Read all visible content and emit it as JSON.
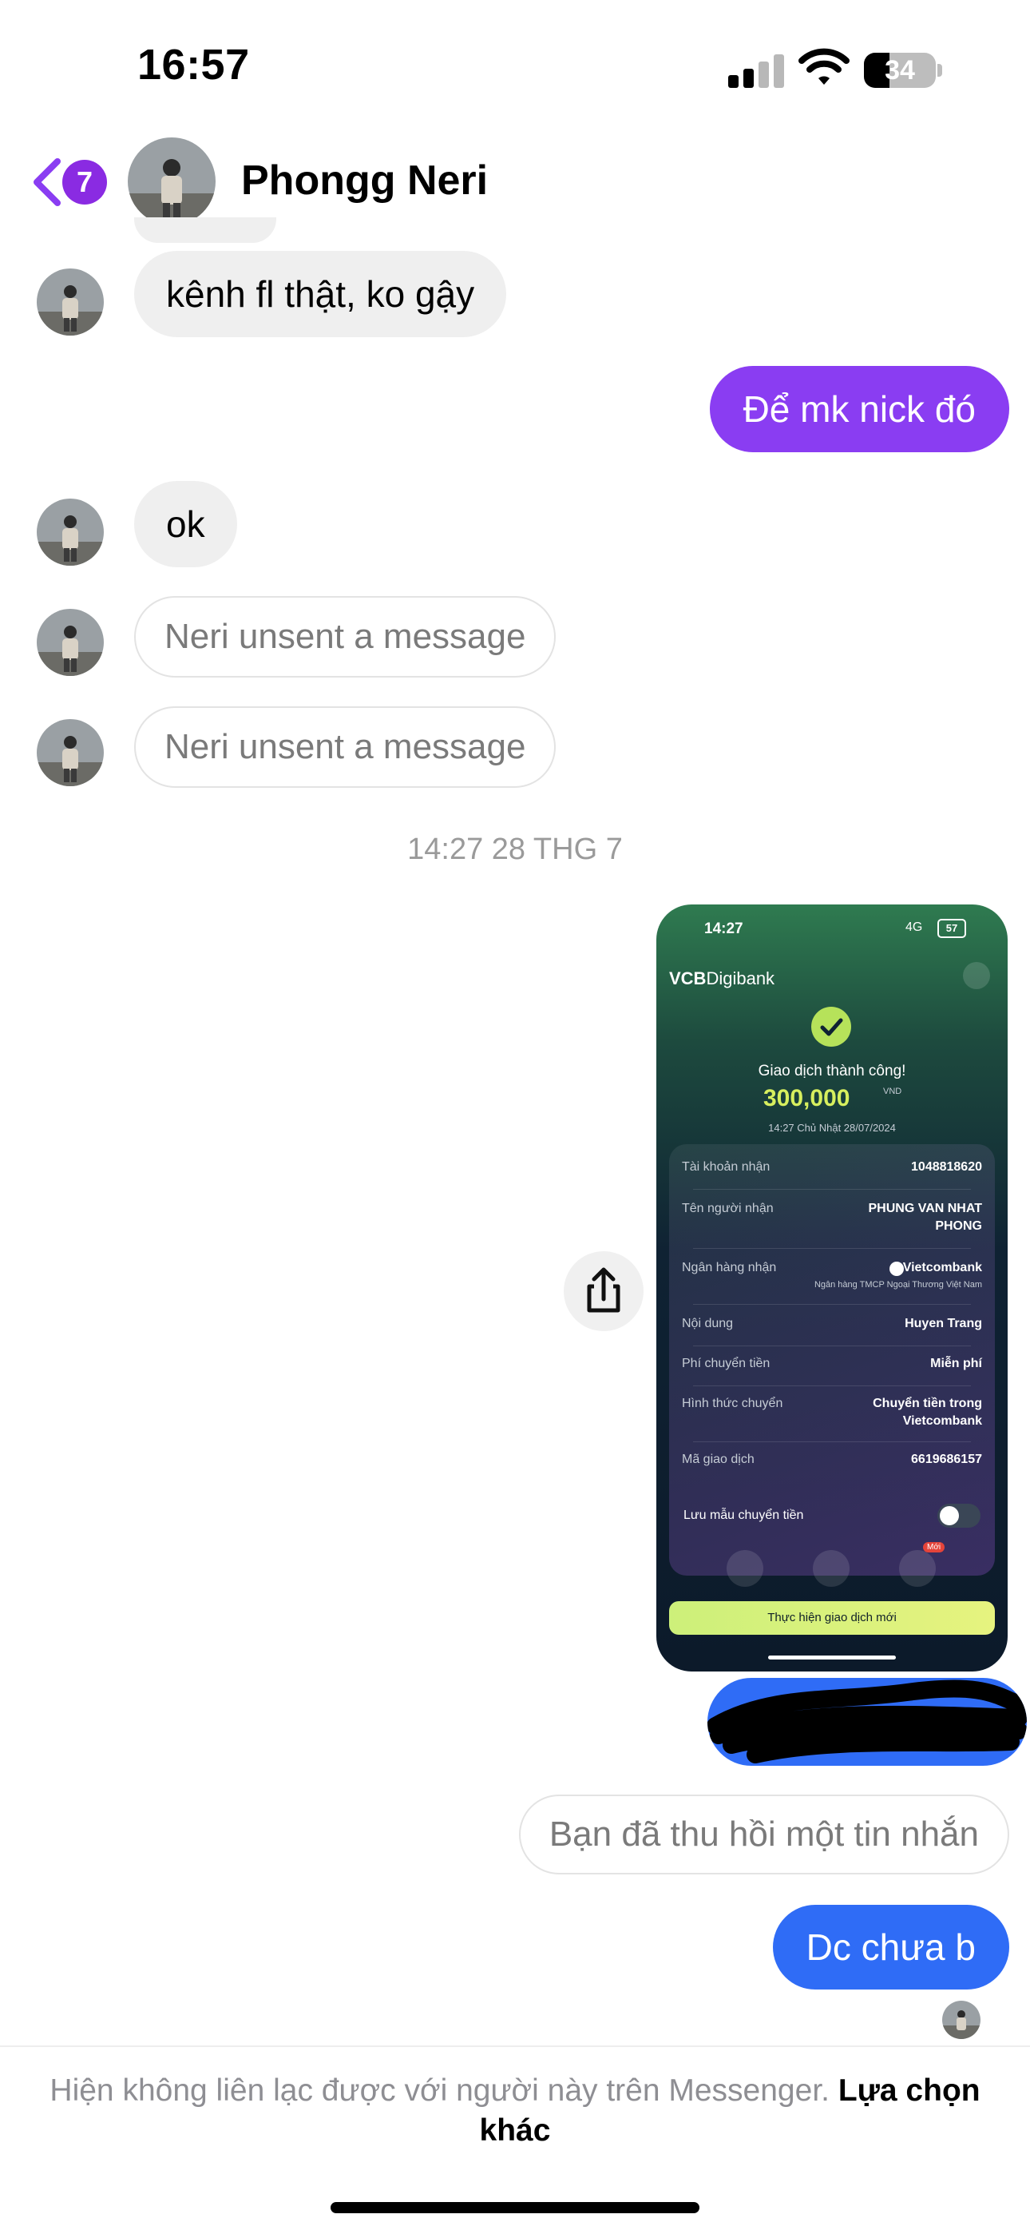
{
  "status_bar": {
    "time": "16:57",
    "battery": "34"
  },
  "header": {
    "unread_count": "7",
    "contact_name": "Phongg Neri"
  },
  "messages": [
    {
      "text": "kênh fl thật, ko gậy"
    },
    {
      "text": "Để mk nick đó"
    },
    {
      "text": "ok"
    },
    {
      "text": "Neri unsent a message"
    },
    {
      "text": "Neri unsent a message"
    },
    {
      "text": "Bạn đã thu hồi một tin nhắn"
    },
    {
      "text": "Dc chưa b"
    }
  ],
  "timestamp": "14:27 28 THG 7",
  "shared_image": {
    "time": "14:27",
    "network": "4G",
    "battery": "57",
    "app_name_bold": "VCB",
    "app_name": "Digibank",
    "success_text": "Giao dịch thành công!",
    "amount": "300,000",
    "currency": "VND",
    "datetime": "14:27 Chủ Nhật 28/07/2024",
    "rows": [
      {
        "label": "Tài khoản nhận",
        "value": "1048818620"
      },
      {
        "label": "Tên người nhận",
        "value": "PHUNG VAN NHAT",
        "value2": "PHONG"
      },
      {
        "label": "Ngân hàng nhận",
        "value": "Vietcombank",
        "value2": "Ngân hàng TMCP Ngoại Thương Việt Nam"
      },
      {
        "label": "Nội dung",
        "value": "Huyen Trang"
      },
      {
        "label": "Phí chuyển tiền",
        "value": "Miễn phí"
      },
      {
        "label": "Hình thức chuyển",
        "value": "Chuyển tiền trong",
        "value2": "Vietcombank"
      },
      {
        "label": "Mã giao dịch",
        "value": "6619686157"
      }
    ],
    "save_template": "Lưu mẫu chuyển tiền",
    "new_badge": "Mới",
    "new_transaction_button": "Thực hiện giao dịch mới"
  },
  "footer": {
    "notice": "Hiện không liên lạc được với người này trên Messenger.",
    "action": "Lựa chọn khác"
  },
  "colors": {
    "accent_purple": "#8a3df2",
    "accent_blue": "#2f6cf6",
    "badge": "#8a2be2"
  }
}
